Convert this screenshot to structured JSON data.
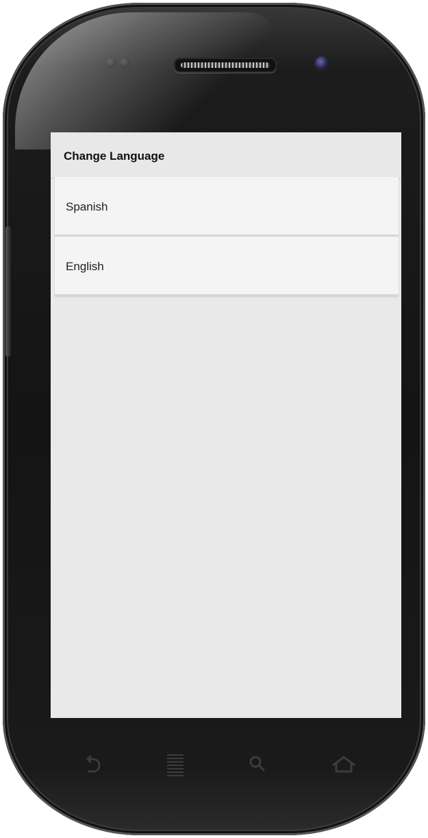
{
  "app": {
    "header_title": "Change Language"
  },
  "languages": [
    {
      "label": "Spanish"
    },
    {
      "label": "English"
    }
  ],
  "nav_icons": [
    "back-icon",
    "menu-icon",
    "search-icon",
    "home-icon"
  ],
  "colors": {
    "screen_background": "#e9e9e9",
    "header_background": "#e8e8e8",
    "list_item_background": "#f4f4f4",
    "phone_body": "#141414",
    "nav_icon": "#3c3c3c"
  }
}
